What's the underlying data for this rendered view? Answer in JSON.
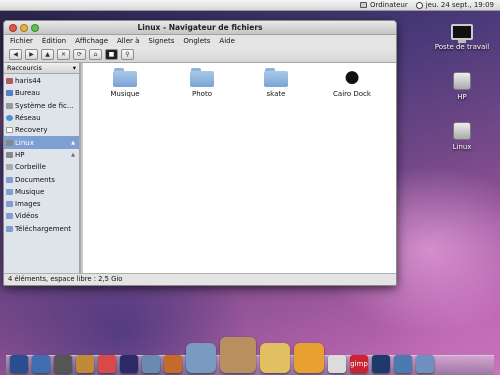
{
  "menubar": {
    "computer_label": "Ordinateur",
    "datetime": "jeu. 24 sept., 19:09"
  },
  "window": {
    "title": "Linux - Navigateur de fichiers",
    "menus": [
      "Fichier",
      "Édition",
      "Affichage",
      "Aller à",
      "Signets",
      "Onglets",
      "Aide"
    ]
  },
  "toolbar": {
    "back": "◀",
    "forward": "▶",
    "up": "▲",
    "stop": "✕",
    "reload": "⟳",
    "home": "⌂",
    "location": "■",
    "search": "⚲"
  },
  "sidebar": {
    "header": "Raccourcis",
    "items": [
      {
        "label": "haris44",
        "icon": "home-icon"
      },
      {
        "label": "Bureau",
        "icon": "desktop-icon"
      },
      {
        "label": "Système de fic...",
        "icon": "filesystem-icon"
      },
      {
        "label": "Réseau",
        "icon": "network-icon"
      },
      {
        "label": "Recovery",
        "icon": "drive-icon"
      },
      {
        "label": "Linux",
        "icon": "drive-icon",
        "eject": "▲",
        "selected": true
      },
      {
        "label": "HP",
        "icon": "drive-icon",
        "eject": "▲"
      },
      {
        "label": "Corbeille",
        "icon": "trash-icon"
      },
      {
        "label": "Documents",
        "icon": "folder-icon"
      },
      {
        "label": "Musique",
        "icon": "folder-icon"
      },
      {
        "label": "Images",
        "icon": "folder-icon"
      },
      {
        "label": "Vidéos",
        "icon": "folder-icon"
      },
      {
        "label": "Téléchargement",
        "icon": "folder-icon"
      }
    ]
  },
  "files": [
    {
      "label": "Musique",
      "icon": "folder-icon"
    },
    {
      "label": "Photo",
      "icon": "folder-icon"
    },
    {
      "label": "skate",
      "icon": "folder-icon"
    },
    {
      "label": "Cairo Dock",
      "icon": "apple-icon"
    }
  ],
  "status": "4 éléments, espace libre : 2,5 Gio",
  "desktop": {
    "icons": [
      {
        "label": "Poste de travail",
        "icon": "computer-icon"
      },
      {
        "label": "HP",
        "icon": "harddisk-icon"
      },
      {
        "label": "Linux",
        "icon": "harddisk-icon"
      }
    ]
  },
  "dock": {
    "gimp_label": "gimp",
    "colors": [
      "#2a4d8f",
      "#3f6fb0",
      "#555555",
      "#c08a3a",
      "#d84a4a",
      "#2b2b6a",
      "#6a8ab0",
      "#c46a2a",
      "#7a9bc0",
      "#b89060",
      "#e0c060",
      "#e8a030",
      "#dcdcdc",
      "#cc2233",
      "#1e3a6a",
      "#4a7ab0",
      "#7090c0"
    ]
  }
}
